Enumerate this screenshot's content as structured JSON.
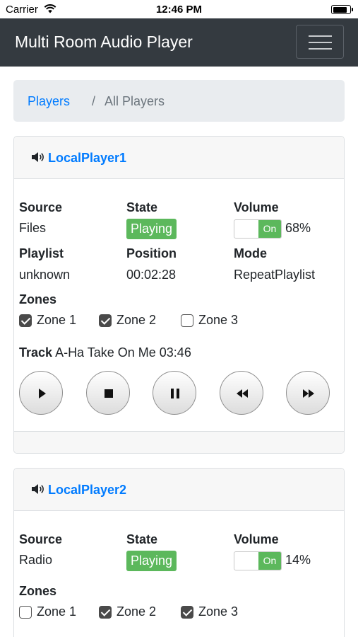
{
  "status_bar": {
    "carrier": "Carrier",
    "time": "12:46 PM",
    "battery_level": 0.9,
    "icons": [
      "wifi-icon",
      "battery-icon"
    ]
  },
  "navbar": {
    "title": "Multi Room Audio Player",
    "menu_icon": "hamburger-icon",
    "background": "#343a40"
  },
  "breadcrumb": {
    "link": "Players",
    "separator": "/",
    "current": "All Players"
  },
  "labels": {
    "source": "Source",
    "state": "State",
    "volume": "Volume",
    "playlist": "Playlist",
    "position": "Position",
    "mode": "Mode",
    "zones": "Zones",
    "track": "Track",
    "toggle_on": "On"
  },
  "players": [
    {
      "name": "LocalPlayer1",
      "source": "Files",
      "state": "Playing",
      "volume_on": true,
      "volume": "68%",
      "playlist": "unknown",
      "position": "00:02:28",
      "mode": "RepeatPlaylist",
      "zones": [
        {
          "label": "Zone 1",
          "checked": true
        },
        {
          "label": "Zone 2",
          "checked": true
        },
        {
          "label": "Zone 3",
          "checked": false
        }
      ],
      "track": "A-Ha Take On Me 03:46",
      "controls": [
        "play-icon",
        "stop-icon",
        "pause-icon",
        "rewind-icon",
        "fast-forward-icon"
      ]
    },
    {
      "name": "LocalPlayer2",
      "source": "Radio",
      "state": "Playing",
      "volume_on": true,
      "volume": "14%",
      "zones": [
        {
          "label": "Zone 1",
          "checked": false
        },
        {
          "label": "Zone 2",
          "checked": true
        },
        {
          "label": "Zone 3",
          "checked": true
        }
      ]
    }
  ],
  "colors": {
    "link": "#007bff",
    "success": "#5cb85c",
    "breadcrumb_bg": "#e9ecef",
    "card_header_bg": "#f7f7f7"
  }
}
